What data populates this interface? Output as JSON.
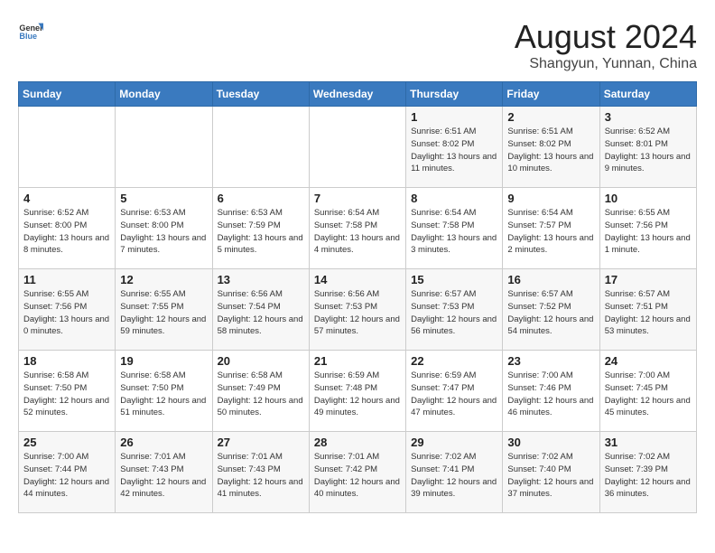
{
  "logo": {
    "general": "General",
    "blue": "Blue"
  },
  "title": {
    "month_year": "August 2024",
    "location": "Shangyun, Yunnan, China"
  },
  "headers": [
    "Sunday",
    "Monday",
    "Tuesday",
    "Wednesday",
    "Thursday",
    "Friday",
    "Saturday"
  ],
  "weeks": [
    [
      {
        "day": "",
        "content": ""
      },
      {
        "day": "",
        "content": ""
      },
      {
        "day": "",
        "content": ""
      },
      {
        "day": "",
        "content": ""
      },
      {
        "day": "1",
        "content": "Sunrise: 6:51 AM\nSunset: 8:02 PM\nDaylight: 13 hours and 11 minutes."
      },
      {
        "day": "2",
        "content": "Sunrise: 6:51 AM\nSunset: 8:02 PM\nDaylight: 13 hours and 10 minutes."
      },
      {
        "day": "3",
        "content": "Sunrise: 6:52 AM\nSunset: 8:01 PM\nDaylight: 13 hours and 9 minutes."
      }
    ],
    [
      {
        "day": "4",
        "content": "Sunrise: 6:52 AM\nSunset: 8:00 PM\nDaylight: 13 hours and 8 minutes."
      },
      {
        "day": "5",
        "content": "Sunrise: 6:53 AM\nSunset: 8:00 PM\nDaylight: 13 hours and 7 minutes."
      },
      {
        "day": "6",
        "content": "Sunrise: 6:53 AM\nSunset: 7:59 PM\nDaylight: 13 hours and 5 minutes."
      },
      {
        "day": "7",
        "content": "Sunrise: 6:54 AM\nSunset: 7:58 PM\nDaylight: 13 hours and 4 minutes."
      },
      {
        "day": "8",
        "content": "Sunrise: 6:54 AM\nSunset: 7:58 PM\nDaylight: 13 hours and 3 minutes."
      },
      {
        "day": "9",
        "content": "Sunrise: 6:54 AM\nSunset: 7:57 PM\nDaylight: 13 hours and 2 minutes."
      },
      {
        "day": "10",
        "content": "Sunrise: 6:55 AM\nSunset: 7:56 PM\nDaylight: 13 hours and 1 minute."
      }
    ],
    [
      {
        "day": "11",
        "content": "Sunrise: 6:55 AM\nSunset: 7:56 PM\nDaylight: 13 hours and 0 minutes."
      },
      {
        "day": "12",
        "content": "Sunrise: 6:55 AM\nSunset: 7:55 PM\nDaylight: 12 hours and 59 minutes."
      },
      {
        "day": "13",
        "content": "Sunrise: 6:56 AM\nSunset: 7:54 PM\nDaylight: 12 hours and 58 minutes."
      },
      {
        "day": "14",
        "content": "Sunrise: 6:56 AM\nSunset: 7:53 PM\nDaylight: 12 hours and 57 minutes."
      },
      {
        "day": "15",
        "content": "Sunrise: 6:57 AM\nSunset: 7:53 PM\nDaylight: 12 hours and 56 minutes."
      },
      {
        "day": "16",
        "content": "Sunrise: 6:57 AM\nSunset: 7:52 PM\nDaylight: 12 hours and 54 minutes."
      },
      {
        "day": "17",
        "content": "Sunrise: 6:57 AM\nSunset: 7:51 PM\nDaylight: 12 hours and 53 minutes."
      }
    ],
    [
      {
        "day": "18",
        "content": "Sunrise: 6:58 AM\nSunset: 7:50 PM\nDaylight: 12 hours and 52 minutes."
      },
      {
        "day": "19",
        "content": "Sunrise: 6:58 AM\nSunset: 7:50 PM\nDaylight: 12 hours and 51 minutes."
      },
      {
        "day": "20",
        "content": "Sunrise: 6:58 AM\nSunset: 7:49 PM\nDaylight: 12 hours and 50 minutes."
      },
      {
        "day": "21",
        "content": "Sunrise: 6:59 AM\nSunset: 7:48 PM\nDaylight: 12 hours and 49 minutes."
      },
      {
        "day": "22",
        "content": "Sunrise: 6:59 AM\nSunset: 7:47 PM\nDaylight: 12 hours and 47 minutes."
      },
      {
        "day": "23",
        "content": "Sunrise: 7:00 AM\nSunset: 7:46 PM\nDaylight: 12 hours and 46 minutes."
      },
      {
        "day": "24",
        "content": "Sunrise: 7:00 AM\nSunset: 7:45 PM\nDaylight: 12 hours and 45 minutes."
      }
    ],
    [
      {
        "day": "25",
        "content": "Sunrise: 7:00 AM\nSunset: 7:44 PM\nDaylight: 12 hours and 44 minutes."
      },
      {
        "day": "26",
        "content": "Sunrise: 7:01 AM\nSunset: 7:43 PM\nDaylight: 12 hours and 42 minutes."
      },
      {
        "day": "27",
        "content": "Sunrise: 7:01 AM\nSunset: 7:43 PM\nDaylight: 12 hours and 41 minutes."
      },
      {
        "day": "28",
        "content": "Sunrise: 7:01 AM\nSunset: 7:42 PM\nDaylight: 12 hours and 40 minutes."
      },
      {
        "day": "29",
        "content": "Sunrise: 7:02 AM\nSunset: 7:41 PM\nDaylight: 12 hours and 39 minutes."
      },
      {
        "day": "30",
        "content": "Sunrise: 7:02 AM\nSunset: 7:40 PM\nDaylight: 12 hours and 37 minutes."
      },
      {
        "day": "31",
        "content": "Sunrise: 7:02 AM\nSunset: 7:39 PM\nDaylight: 12 hours and 36 minutes."
      }
    ]
  ]
}
